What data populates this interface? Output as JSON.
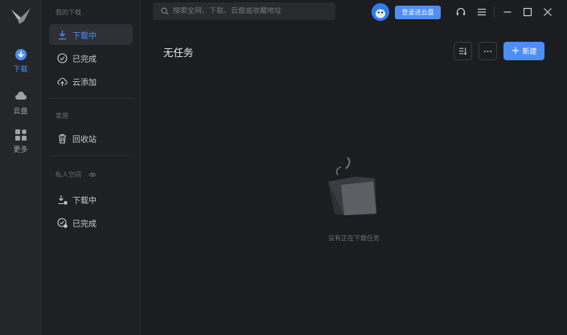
{
  "rail": {
    "items": [
      {
        "label": "下载"
      },
      {
        "label": "云盘"
      },
      {
        "label": "更多"
      }
    ]
  },
  "sidebar": {
    "section_downloads": "我的下载",
    "downloads": [
      {
        "label": "下载中"
      },
      {
        "label": "已完成"
      },
      {
        "label": "云添加"
      }
    ],
    "section_common": "常用",
    "common": [
      {
        "label": "回收站"
      }
    ],
    "section_private": "私人空间",
    "private": [
      {
        "label": "下载中"
      },
      {
        "label": "已完成"
      }
    ]
  },
  "topbar": {
    "search_placeholder": "搜索全网、下载、云盘或收藏地址",
    "login_label": "登录送云盘"
  },
  "main": {
    "title": "无任务",
    "new_label": "新建",
    "empty_text": "没有正在下载任务"
  },
  "colors": {
    "accent": "#4d8ff5",
    "background": "#1c1d20",
    "sidebar": "#1f2023",
    "rail": "#25262a"
  }
}
